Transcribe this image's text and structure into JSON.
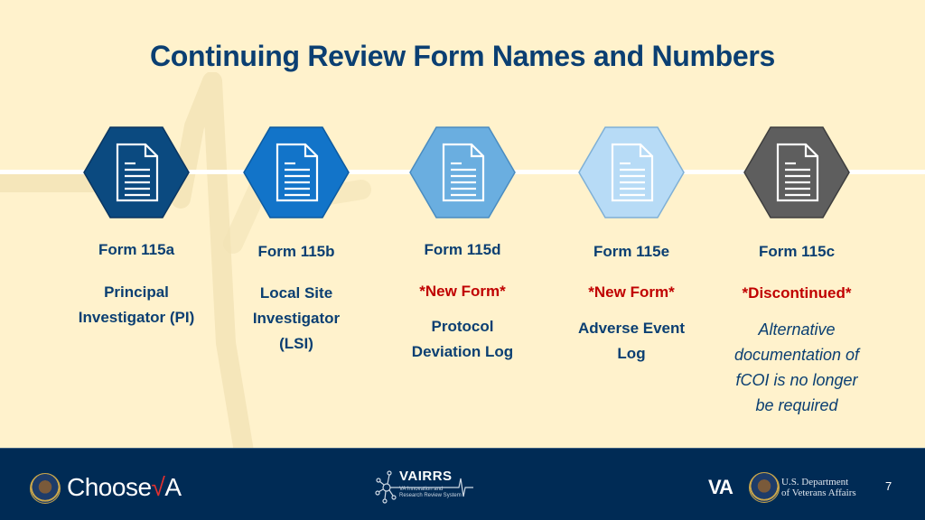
{
  "title": "Continuing Review Form Names and Numbers",
  "forms": [
    {
      "icon": "document-icon",
      "hex_color": "#0b4a80",
      "form_label": "Form 115a",
      "status": "",
      "description_lines": [
        "Principal",
        "Investigator (PI)"
      ],
      "description_italic": false
    },
    {
      "icon": "document-icon",
      "hex_color": "#1274c9",
      "form_label": "Form 115b",
      "status": "",
      "description_lines": [
        "Local Site",
        "Investigator",
        "(LSI)"
      ],
      "description_italic": false
    },
    {
      "icon": "document-icon",
      "hex_color": "#6aaee0",
      "form_label": "Form 115d",
      "status": "*New Form*",
      "description_lines": [
        "Protocol",
        "Deviation Log"
      ],
      "description_italic": false
    },
    {
      "icon": "document-icon",
      "hex_color": "#b7dbf6",
      "form_label": "Form 115e",
      "status": "*New Form*",
      "description_lines": [
        "Adverse Event",
        "Log"
      ],
      "description_italic": false
    },
    {
      "icon": "document-icon",
      "hex_color": "#5e5e5e",
      "form_label": "Form 115c",
      "status": "*Discontinued*",
      "description_lines": [
        "Alternative",
        "documentation of",
        "fCOI is no longer",
        "be required"
      ],
      "description_italic": true
    }
  ],
  "colors": {
    "background": "#fff2cc",
    "title": "#0b3f72",
    "status_red": "#c00000",
    "footer": "#002b55"
  },
  "footer": {
    "left_logo_seal": "va-seal-icon",
    "left_logo_text": "Choose",
    "left_logo_check": "√",
    "left_logo_end": "A",
    "center_logo_name": "VAIRRS",
    "center_logo_sub": "VA Innovation and Research Review System",
    "right_logo_mark": "VA",
    "right_dept_line1": "U.S. Department",
    "right_dept_line2": "of Veterans Affairs",
    "page_number": "7"
  }
}
